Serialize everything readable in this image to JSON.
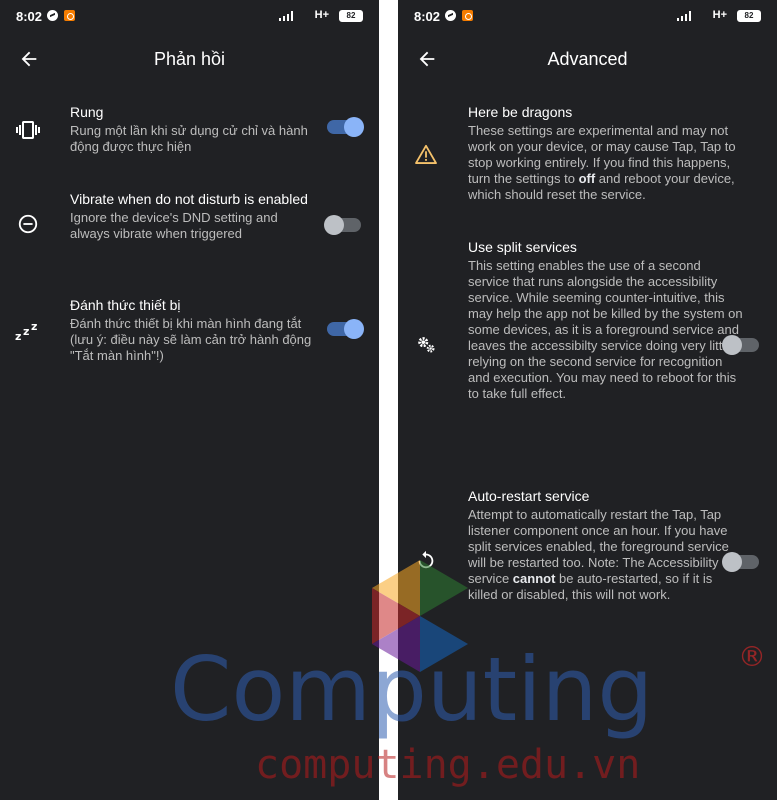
{
  "status": {
    "time": "8:02",
    "network": "H+",
    "battery": "82"
  },
  "left": {
    "title": "Phản hồi",
    "items": [
      {
        "title": "Rung",
        "desc": "Rung một lần khi sử dụng cử chỉ và hành động được thực hiện",
        "enabled": true
      },
      {
        "title": "Vibrate when do not disturb is enabled",
        "desc": "Ignore the device's DND setting and always vibrate when triggered",
        "enabled": false
      },
      {
        "title": "Đánh thức thiết bị",
        "desc": "Đánh thức thiết bị khi màn hình đang tắt (lưu ý: điều này sẽ làm cản trở hành động \"Tắt màn hình\"!)",
        "enabled": true
      }
    ]
  },
  "right": {
    "title": "Advanced",
    "dragons": {
      "title": "Here be dragons",
      "desc_before": "These settings are experimental and may not work on your device, or may cause Tap, Tap to stop working entirely. If you find this happens, turn the settings to ",
      "desc_bold": "off",
      "desc_after": " and reboot your device, which should reset the service."
    },
    "split": {
      "title": "Use split services",
      "desc": "This setting enables the use of a second service that runs alongside the accessibility service. While seeming counter-intuitive, this may help the app not be killed by the system on some devices, as it is a foreground service and leaves the accessibilty service doing very little, relying on the second service for recognition and execution. You may need to reboot for this to take full effect.",
      "enabled": false
    },
    "restart": {
      "title": "Auto-restart service",
      "desc_before": "Attempt to automatically restart the Tap, Tap listener component once an hour. If you have split services enabled, the foreground service will be restarted too. Note: The Accessibility service ",
      "desc_bold": "cannot",
      "desc_after": " be auto-restarted, so if it is killed or disabled, this will not work.",
      "enabled": false
    }
  },
  "watermark": {
    "brand": "Computing",
    "registered": "®",
    "url": "computing.edu.vn"
  },
  "colors": {
    "background": "#202124",
    "accent": "#8ab4f8",
    "track_on": "#3f67a6",
    "warning": "#f5c26b"
  }
}
